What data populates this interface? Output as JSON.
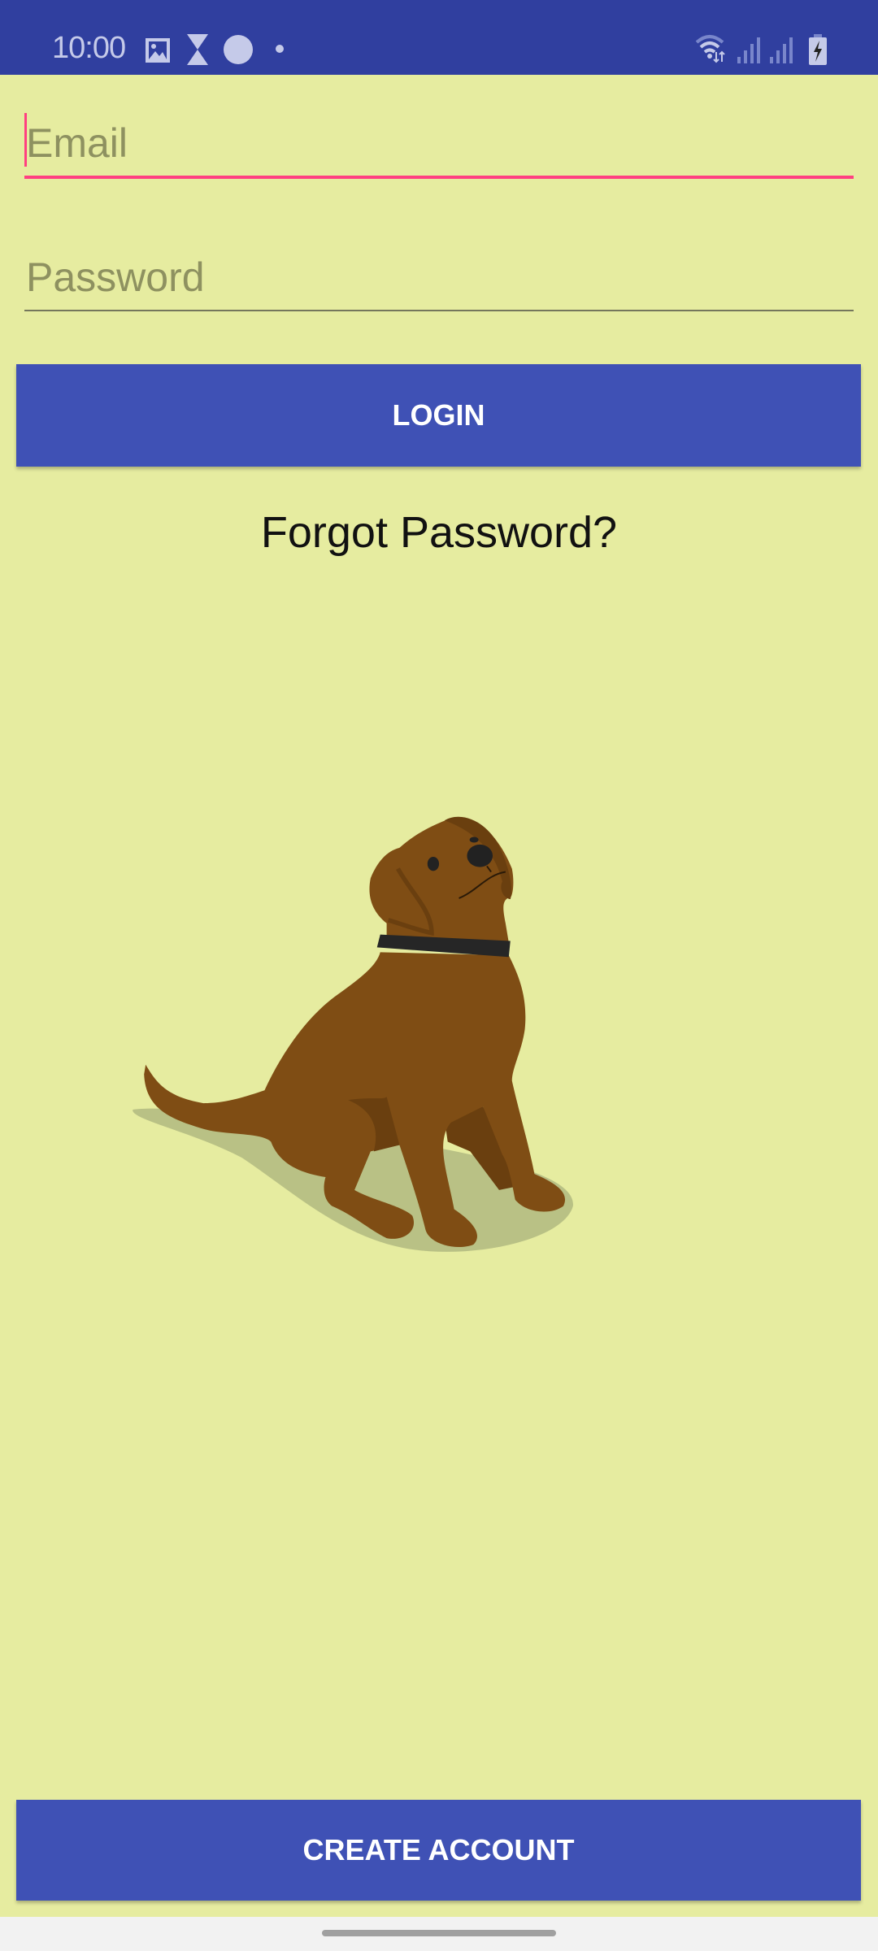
{
  "status_bar": {
    "time": "10:00",
    "icons": [
      "image-icon",
      "hourglass-icon",
      "circle-icon",
      "dot-icon",
      "wifi-icon",
      "signal-icon",
      "signal-icon",
      "battery-charging-icon"
    ]
  },
  "login_form": {
    "email_placeholder": "Email",
    "password_placeholder": "Password",
    "login_label": "LOGIN",
    "forgot_label": "Forgot Password?"
  },
  "illustration": {
    "name": "sitting-dog"
  },
  "create_account_label": "CREATE ACCOUNT",
  "colors": {
    "primary": "#3f51b5",
    "status": "#303f9f",
    "accent": "#ff4081",
    "background": "#e6eca0"
  }
}
